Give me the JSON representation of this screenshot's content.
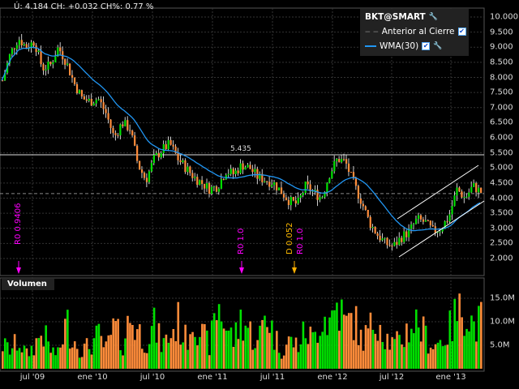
{
  "header": {
    "quote": "Ú: 4.184 CH: +0.032 CH%: 0.77 %"
  },
  "legend": {
    "symbol": "BKT@SMART",
    "items": [
      {
        "label": "Anterior al Cierre",
        "style": "dashed"
      },
      {
        "label": "WMA(30)",
        "style": "solid"
      }
    ]
  },
  "colors": {
    "up": "#00e000",
    "down": "#ff8c3a",
    "wma": "#2196f3",
    "div": "#ff00ff",
    "dividend": "#ffb000"
  },
  "volume_panel": {
    "title": "Volumen"
  },
  "price_level_label": "5.435",
  "annotations": [
    {
      "text": "R0 0.9406",
      "color": "#ff00ff"
    },
    {
      "text": "R0 1.0",
      "color": "#ff00ff"
    },
    {
      "text": "D 0.052",
      "color": "#ffb000"
    },
    {
      "text": "R0 1.0",
      "color": "#ff00ff"
    }
  ],
  "chart_data": {
    "type": "candlestick",
    "y_ticks": [
      "10.000",
      "9.500",
      "9.000",
      "8.500",
      "8.000",
      "7.500",
      "7.000",
      "6.500",
      "6.000",
      "5.500",
      "5.000",
      "4.500",
      "4.000",
      "3.500",
      "3.000",
      "2.500",
      "2.000"
    ],
    "ylim": [
      2.0,
      10.0
    ],
    "volume_ticks": [
      "15.0M",
      "10.0M",
      "5.0M"
    ],
    "x_ticks": [
      "jul '09",
      "ene '10",
      "jul '10",
      "ene '11",
      "jul '11",
      "ene '12",
      "jul '12",
      "ene '13"
    ],
    "prev_close": 4.152,
    "indicator": "WMA(30)",
    "close_anchors": [
      7.9,
      8.8,
      9.3,
      9.0,
      9.2,
      8.3,
      8.4,
      9.0,
      8.5,
      7.8,
      7.3,
      7.2,
      7.3,
      6.8,
      6.0,
      6.5,
      6.3,
      5.1,
      4.6,
      5.3,
      5.6,
      5.8,
      5.3,
      5.0,
      4.7,
      4.5,
      4.3,
      4.4,
      4.9,
      4.8,
      5.1,
      5.0,
      4.7,
      4.6,
      4.5,
      4.2,
      3.9,
      3.8,
      4.4,
      4.2,
      4.0,
      4.8,
      5.3,
      5.2,
      4.5,
      3.9,
      3.2,
      2.8,
      2.5,
      2.4,
      2.7,
      2.9,
      3.3,
      3.2,
      2.9,
      3.0,
      3.4,
      4.3,
      4.0,
      4.4,
      4.2
    ],
    "volume_anchors_m": [
      5,
      4,
      6,
      3,
      5,
      8,
      4,
      3,
      10,
      6,
      4,
      5,
      7,
      4,
      9,
      5,
      11,
      8,
      6,
      9,
      5,
      7,
      10,
      6,
      12,
      7,
      5,
      14,
      9,
      6,
      11,
      8,
      5,
      13,
      7,
      4,
      6,
      5,
      8,
      6,
      12,
      10,
      14,
      9,
      11,
      6,
      8,
      12,
      7,
      5,
      6,
      9,
      10,
      7,
      5,
      6,
      8,
      12,
      14,
      9,
      10
    ]
  }
}
